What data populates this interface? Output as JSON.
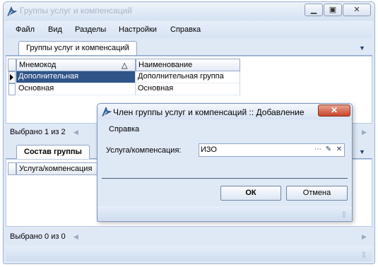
{
  "main_window": {
    "title": "Группы услуг и компенсаций"
  },
  "menu": [
    "Файл",
    "Вид",
    "Разделы",
    "Настройки",
    "Справка"
  ],
  "top_panel": {
    "tab_label": "Группы услуг и компенсаций",
    "columns": [
      "Мнемокод",
      "Наименование"
    ],
    "rows": [
      {
        "code": "Дополнительная",
        "name": "Дополнительная группа"
      },
      {
        "code": "Основная",
        "name": "Основная"
      }
    ],
    "status": "Выбрано 1 из 2"
  },
  "bottom_panel": {
    "tab_label": "Состав группы",
    "columns": [
      "Услуга/компенсация"
    ],
    "status": "Выбрано 0 из 0"
  },
  "dialog": {
    "title": "Член группы услуг и компенсаций :: Добавление",
    "menu_item": "Справка",
    "field_label": "Услуга/компенсация:",
    "field_value": "ИЗО",
    "ok_label": "ОК",
    "cancel_label": "Отмена"
  },
  "colors": {
    "selected_row": "#2f5487",
    "window_background": "#dfe8f5",
    "close_button": "#c9442b"
  },
  "icons": [
    "app-icon",
    "minimize-icon",
    "maximize-icon",
    "close-icon",
    "sort-ascending-icon",
    "dropdown-arrow-icon",
    "ellipsis-icon",
    "edit-icon",
    "clear-icon",
    "size-grip-icon"
  ]
}
